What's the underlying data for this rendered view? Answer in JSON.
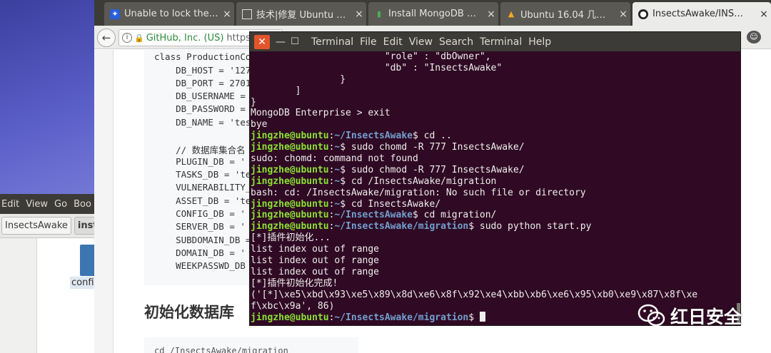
{
  "file_manager": {
    "menu": [
      "Edit",
      "View",
      "Go",
      "Boo"
    ],
    "breadcrumbs": [
      "InsectsAwake",
      "inst"
    ],
    "file_label": "confi"
  },
  "browser": {
    "tabs": [
      {
        "label": "Unable to lock the…",
        "icon": "baidu-icon"
      },
      {
        "label": "技术|修复 Ubuntu …",
        "icon": "page-icon"
      },
      {
        "label": "Install MongoDB …",
        "icon": "mongodb-icon"
      },
      {
        "label": "Ubuntu 16.04 几…",
        "icon": "ubuntu-icon"
      },
      {
        "label": "InsectsAwake/INS…",
        "icon": "github-icon"
      }
    ],
    "url_org": "GitHub, Inc. (US)",
    "url_text": "https://"
  },
  "page": {
    "code_lines": [
      "class ProductionCo",
      "    DB_HOST = '127",
      "    DB_PORT = 2701",
      "    DB_USERNAME =",
      "    DB_PASSWORD =",
      "    DB_NAME = 'tes",
      "",
      "    // 数据库集合名",
      "    PLUGIN_DB = '",
      "    TASKS_DB = 'te",
      "    VULNERABILITY_",
      "    ASSET_DB = 'te",
      "    CONFIG_DB = '",
      "    SERVER_DB = '",
      "    SUBDOMAIN_DB =",
      "    DOMAIN_DB = '",
      "    WEEKPASSWD_DB"
    ],
    "heading": "初始化数据库",
    "code2": "cd /InsectsAwake/migration"
  },
  "terminal": {
    "menu": [
      "Terminal",
      "File",
      "Edit",
      "View",
      "Search",
      "Terminal",
      "Help"
    ],
    "prompt_user": "jingzhe@ubuntu",
    "lines": [
      {
        "text": "                        \"role\" : \"dbOwner\","
      },
      {
        "text": "                        \"db\" : \"InsectsAwake\""
      },
      {
        "text": "                }"
      },
      {
        "text": "        ]"
      },
      {
        "text": "}"
      },
      {
        "text": "MongoDB Enterprise > exit"
      },
      {
        "text": "bye"
      },
      {
        "path": "~/InsectsAwake",
        "cmd": "cd .."
      },
      {
        "path": "~",
        "cmd": "sudo chomd -R 777 InsectsAwake/"
      },
      {
        "text": "sudo: chomd: command not found"
      },
      {
        "path": "~",
        "cmd": "sudo chmod -R 777 InsectsAwake/"
      },
      {
        "path": "~",
        "cmd": "cd /InsectsAwake/migration"
      },
      {
        "text": "bash: cd: /InsectsAwake/migration: No such file or directory"
      },
      {
        "path": "~",
        "cmd": "cd InsectsAwake/"
      },
      {
        "path": "~/InsectsAwake",
        "cmd": "cd migration/"
      },
      {
        "path": "~/InsectsAwake/migration",
        "cmd": "sudo python start.py"
      },
      {
        "text": "[*]插件初始化..."
      },
      {
        "text": "list index out of range"
      },
      {
        "text": "list index out of range"
      },
      {
        "text": "list index out of range"
      },
      {
        "text": "[*]插件初始化完成!"
      },
      {
        "text": "('[*]\\xe5\\xbd\\x93\\xe5\\x89\\x8d\\xe6\\x8f\\x92\\xe4\\xbb\\xb6\\xe6\\x95\\xb0\\xe9\\x87\\x8f\\xe"
      },
      {
        "text": "f\\xbc\\x9a', 86)"
      },
      {
        "path": "~/InsectsAwake/migration",
        "cmd": "",
        "cursor": true
      }
    ]
  },
  "watermark": {
    "text": "红日安全"
  },
  "colors": {
    "terminal_bg": "#300a24",
    "prompt_user": "#8ae234",
    "prompt_path": "#729fcf",
    "close_button": "#e3542a"
  }
}
